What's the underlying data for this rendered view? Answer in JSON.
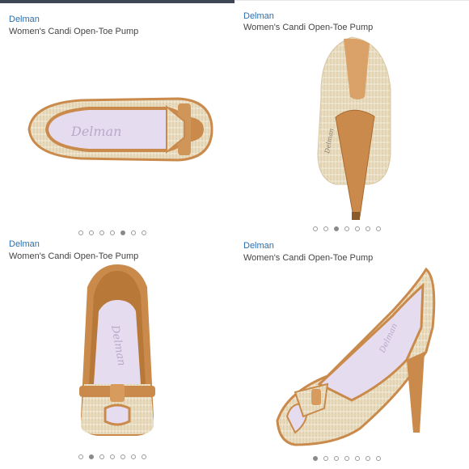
{
  "products": [
    {
      "brand": "Delman",
      "title": "Women's Candi Open-Toe Pump",
      "dots": 7,
      "active_dot": 4
    },
    {
      "brand": "Delman",
      "title": "Women's Candi Open-Toe Pump",
      "dots": 7,
      "active_dot": 2
    },
    {
      "brand": "Delman",
      "title": "Women's Candi Open-Toe Pump",
      "dots": 7,
      "active_dot": 1
    },
    {
      "brand": "Delman",
      "title": "Women's Candi Open-Toe Pump",
      "dots": 7,
      "active_dot": 0
    }
  ],
  "insole_logo": "Delman",
  "colors": {
    "brand_link": "#2a6fb0",
    "tan_leather": "#c98a4b",
    "raffia": "#e8dcc0",
    "lining": "#e6dcf0"
  }
}
